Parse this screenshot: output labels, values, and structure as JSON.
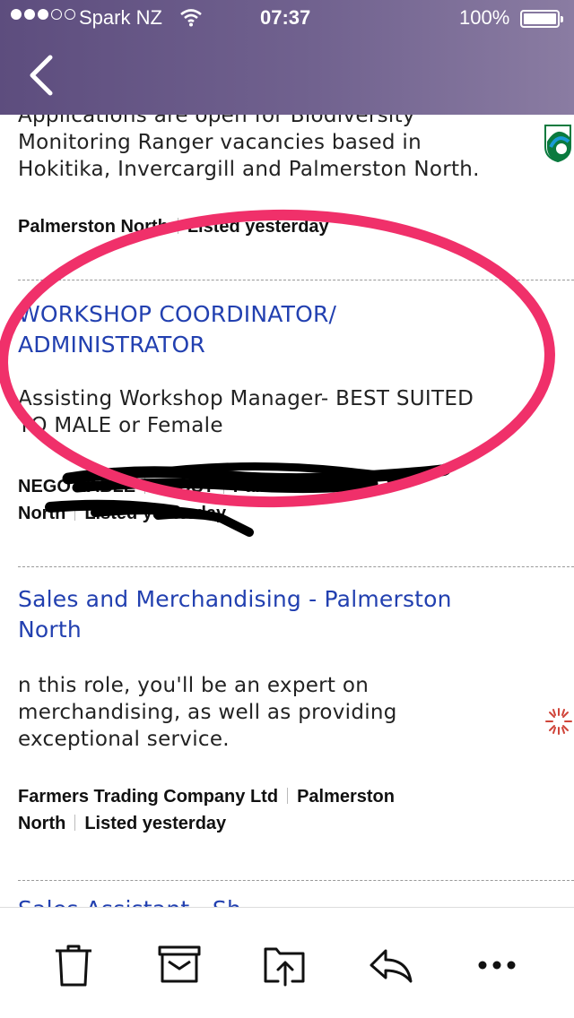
{
  "status_bar": {
    "carrier": "Spark NZ",
    "time": "07:37",
    "battery": "100%"
  },
  "nav": {
    "back_icon": "chevron-left-icon"
  },
  "listings": [
    {
      "description": "Applications are open for Biodiversity Monitoring Ranger vacancies based in Hokitika, Invercargill and Palmerston North.",
      "desc_line1": "Applications are open for Biodiversity",
      "desc_line2": "Monitoring Ranger vacancies based in",
      "desc_line3": "Hokitika, Invercargill and Palmerston North.",
      "location": "Palmerston North",
      "listed": "Listed yesterday",
      "logo_icon": "department-of-conservation-logo-icon"
    },
    {
      "title_line1": "WORKSHOP COORDINATOR/",
      "title_line2": "ADMINISTRATOR",
      "desc_line1": "Assisting Workshop Manager- BEST SUITED",
      "desc_line2": "TO MALE or Female",
      "meta_line1_a": "NEGOTIABLE",
      "meta_line1_b": "TRUST",
      "meta_line1_c": "Palmerston",
      "meta_line2_a": "North",
      "meta_line2_b": "Listed yesterday"
    },
    {
      "title_line1": "Sales and Merchandising - Palmerston",
      "title_line2": "North",
      "desc_line1": "n this role, you'll be an expert on",
      "desc_line2": "merchandising, as well as providing",
      "desc_line3": "exceptional service.",
      "company": "Farmers Trading Company Ltd",
      "location_a": "Palmerston",
      "location_b": "North",
      "listed": "Listed yesterday",
      "logo_icon": "farmers-logo-icon"
    },
    {
      "title_partial": "Sales Assistant - Sh"
    }
  ],
  "annotations": {
    "highlight_color": "#f0306a",
    "redaction_color": "#000000"
  },
  "toolbar": {
    "items": [
      "trash-icon",
      "archive-icon",
      "move-to-folder-icon",
      "reply-icon",
      "more-icon"
    ]
  }
}
